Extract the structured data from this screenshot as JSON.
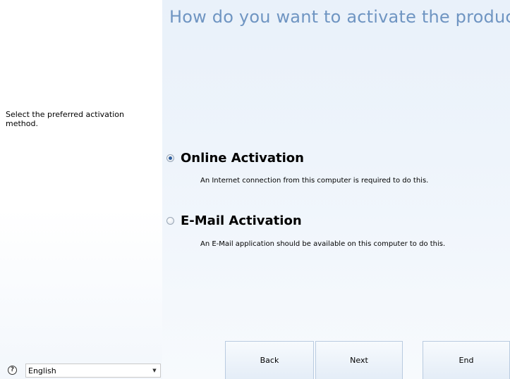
{
  "title": "How do you want to activate the product?",
  "instruction": "Select the preferred activation method.",
  "options": [
    {
      "label": "Online Activation",
      "description": "An Internet connection from this computer is required to do this.",
      "selected": true
    },
    {
      "label": "E-Mail Activation",
      "description": "An E-Mail application should be available on this computer to do this.",
      "selected": false
    }
  ],
  "buttons": {
    "back": "Back",
    "next": "Next",
    "end": "End"
  },
  "language": {
    "selected": "English"
  },
  "icons": {
    "help": "help-icon",
    "dropdown": "chevron-down-icon"
  }
}
